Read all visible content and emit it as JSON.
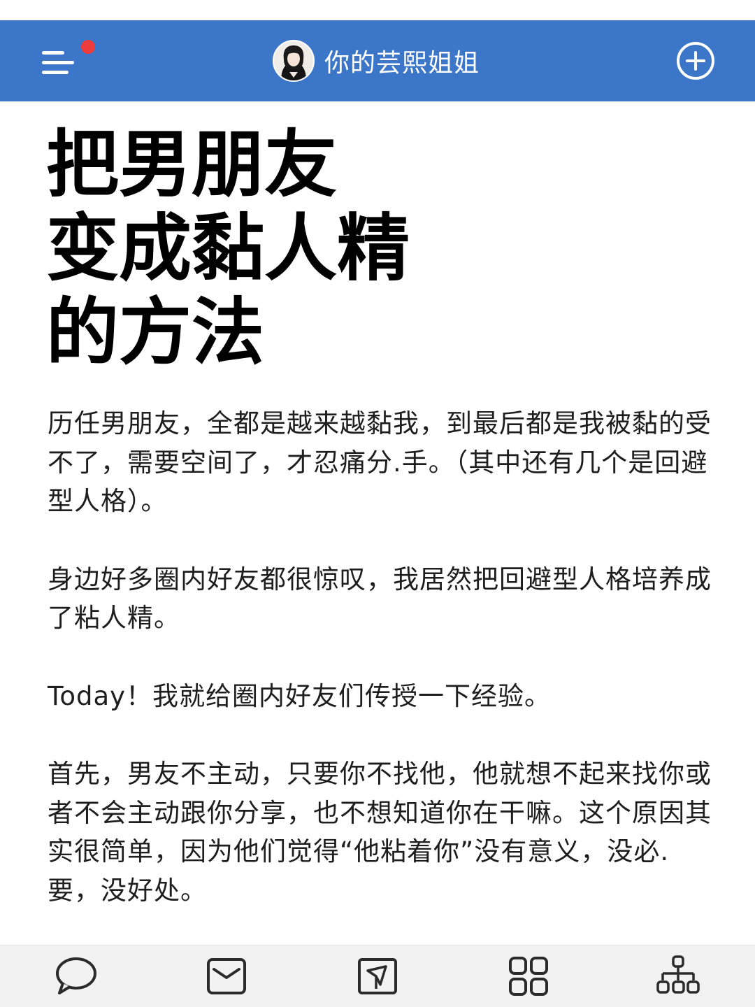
{
  "header": {
    "title": "你的芸熙姐姐",
    "menu_icon": "menu-icon",
    "notification_dot_color": "#ee3b3b",
    "add_icon": "plus-circle-icon",
    "background_color": "#3b76c8"
  },
  "article": {
    "title_lines": [
      "把男朋友",
      "变成黏人精",
      "的方法"
    ],
    "paragraphs": [
      "历任男朋友，全都是越来越黏我，到最后都是我被黏的受不了，需要空间了，才忍痛分.手。（其中还有几个是回避型人格）。",
      "身边好多圈内好友都很惊叹，我居然把回避型人格培养成了粘人精。",
      "Today！我就给圈内好友们传授一下经验。",
      "首先，男友不主动，只要你不找他，他就想不起来找你或者不会主动跟你分享，也不想知道你在干嘛。这个原因其实很简单，因为他们觉得“他粘着你”没有意义，没必.要，没好处。"
    ]
  },
  "bottom_nav": {
    "items": [
      {
        "icon": "chat-bubble-icon"
      },
      {
        "icon": "mail-icon"
      },
      {
        "icon": "send-icon"
      },
      {
        "icon": "grid-icon"
      },
      {
        "icon": "org-chart-icon"
      }
    ]
  }
}
